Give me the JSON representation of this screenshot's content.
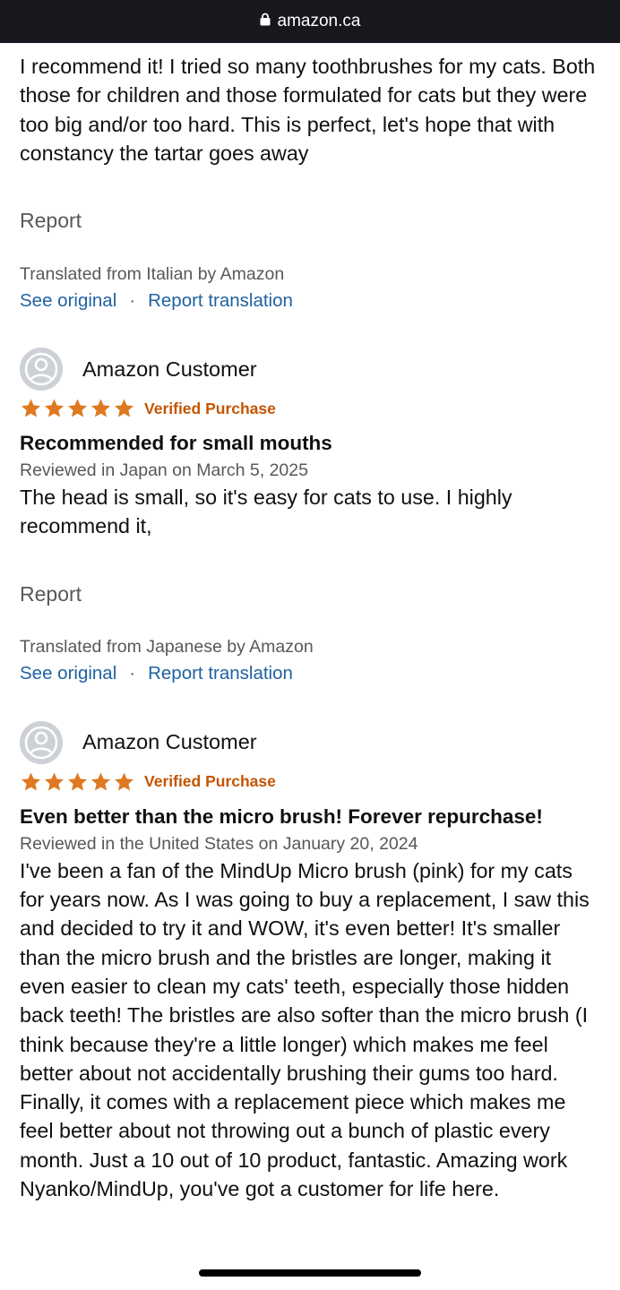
{
  "browser": {
    "domain": "amazon.ca",
    "lock_icon": "lock-icon"
  },
  "top_review": {
    "body": "I recommend it! I tried so many toothbrushes for my cats. Both those for children and those formulated for cats but they were too big and/or too hard. This is perfect, let's hope that with constancy the tartar goes away",
    "report_label": "Report",
    "translation_note": "Translated from Italian by Amazon",
    "see_original_label": "See original",
    "separator": "·",
    "report_translation_label": "Report translation"
  },
  "reviews": [
    {
      "reviewer": "Amazon Customer",
      "rating": 5,
      "verified_label": "Verified Purchase",
      "title": "Recommended for small mouths",
      "date": "Reviewed in Japan on March 5, 2025",
      "body": "The head is small, so it's easy for cats to use. I highly recommend it,",
      "report_label": "Report",
      "translation_note": "Translated from Japanese by Amazon",
      "see_original_label": "See original",
      "separator": "·",
      "report_translation_label": "Report translation"
    },
    {
      "reviewer": "Amazon Customer",
      "rating": 5,
      "verified_label": "Verified Purchase",
      "title": "Even better than the micro brush! Forever repurchase!",
      "date": "Reviewed in the United States on January 20, 2024",
      "body": "I've been a fan of the MindUp Micro brush (pink) for my cats for years now. As I was going to buy a replacement, I saw this and decided to try it and WOW, it's even better! It's smaller than the micro brush and the bristles are longer, making it even easier to clean my cats' teeth, especially those hidden back teeth! The bristles are also softer than the micro brush (I think because they're a little longer) which makes me feel better about not accidentally brushing their gums too hard. Finally, it comes with a replacement piece which makes me feel better about not throwing out a bunch of plastic every month. Just a 10 out of 10 product, fantastic. Amazing work Nyanko/MindUp, you've got a customer for life here."
    }
  ],
  "colors": {
    "star": "#de7921",
    "verified": "#c45500",
    "link": "#2162a1",
    "secondary_text": "#565959",
    "url_bar": "#16181d"
  }
}
